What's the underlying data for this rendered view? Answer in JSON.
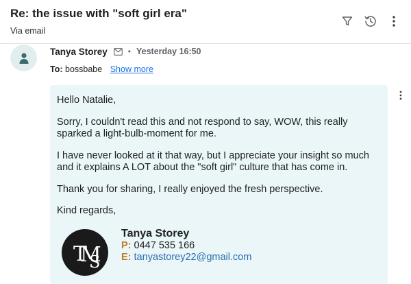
{
  "header": {
    "subject": "Re: the issue with \"soft girl era\"",
    "via": "Via email",
    "icons": [
      "filter-icon",
      "history-icon",
      "more-vertical-icon"
    ]
  },
  "message": {
    "sender_name": "Tanya Storey",
    "timestamp": "Yesterday 16:50",
    "separator": "•",
    "to_label": "To:",
    "to_value": "bossbabe",
    "show_more": "Show more",
    "body": [
      "Hello Natalie,",
      "Sorry, I couldn't read this and not respond to say, WOW, this really sparked a light-bulb-moment for me.",
      "I have never looked at it that way, but I appreciate your insight so much and it explains A LOT about the \"soft girl\" culture that has come in.",
      "Thank you for sharing, I really enjoyed the fresh perspective.",
      "Kind regards,"
    ]
  },
  "signature": {
    "name": "Tanya Storey",
    "phone_label": "P:",
    "phone": "0447 535 166",
    "email_label": "E:",
    "email": "tanyastorey22@gmail.com",
    "logo_text": "TMS"
  },
  "colors": {
    "body_background": "#eaf6f8",
    "avatar_background": "#e2eeee",
    "avatar_icon": "#3d6b6b",
    "link": "#1a73e8",
    "signature_label": "#c0792a",
    "signature_email": "#2a6fb0"
  }
}
